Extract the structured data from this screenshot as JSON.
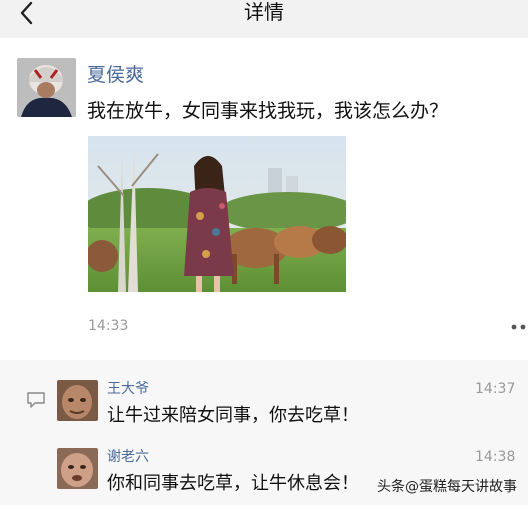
{
  "header": {
    "title": "详情"
  },
  "post": {
    "author": "夏侯爽",
    "text": "我在放牛，女同事来找我玩，我该怎么办？",
    "time": "14:33"
  },
  "comments": [
    {
      "author": "王大爷",
      "time": "14:37",
      "text": "让牛过来陪女同事，你去吃草！"
    },
    {
      "author": "谢老六",
      "time": "14:38",
      "text": "你和同事去吃草，让牛休息会！"
    }
  ],
  "watermark": "头条@蛋糕每天讲故事",
  "icons": {
    "back": "chevron-left-icon",
    "more": "more-dots-icon",
    "comment": "comment-icon"
  },
  "colors": {
    "header_bg": "#f2f2f2",
    "name_link": "#4a6a9a",
    "time_gray": "#999999",
    "comment_bg": "#f7f7f7"
  }
}
